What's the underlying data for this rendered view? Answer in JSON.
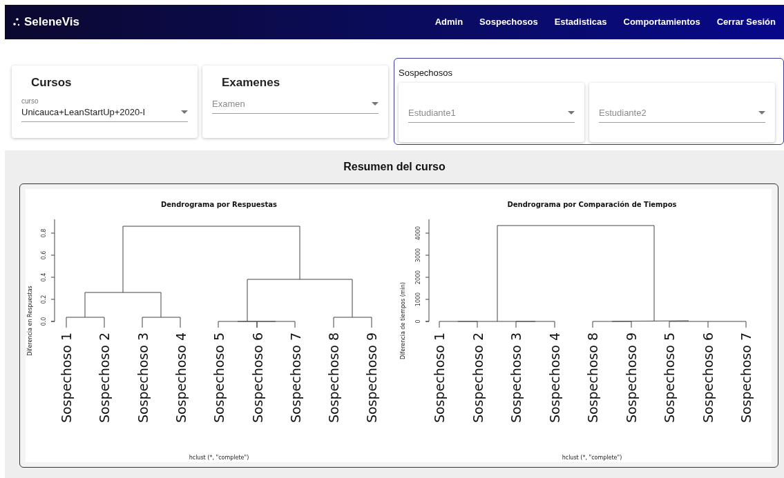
{
  "navbar": {
    "brand": "SeleneVis",
    "links": [
      "Admin",
      "Sospechosos",
      "Estadisticas",
      "Comportamientos",
      "Cerrar Sesión"
    ]
  },
  "filters": [
    {
      "title": "Cursos",
      "label": "curso",
      "value": "Unicauca+LeanStartUp+2020-I"
    },
    {
      "title": "Examenes",
      "placeholder": "Examen"
    }
  ],
  "suspects": {
    "title": "Sospechosos",
    "fields": [
      {
        "placeholder": "Estudiante1"
      },
      {
        "placeholder": "Estudiante2"
      }
    ]
  },
  "summary": {
    "title": "Resumen del curso",
    "plots": [
      {
        "title": "Dendrograma por Respuestas",
        "ylabel": "Diferencia en Respuestas",
        "yticks": [
          "0.0",
          "0.2",
          "0.4",
          "0.6",
          "0.8"
        ],
        "leaves": [
          "Sospechoso 1",
          "Sospechoso 2",
          "Sospechoso 3",
          "Sospechoso 4",
          "Sospechoso 5",
          "Sospechoso 6",
          "Sospechoso 7",
          "Sospechoso 8",
          "Sospechoso 9"
        ],
        "xlabel": "hclust (*, \"complete\")"
      },
      {
        "title": "Dendrograma por Comparación de Tiempos",
        "ylabel": "Diferencia de tiempos (min)",
        "yticks": [
          "0",
          "1000",
          "2000",
          "3000",
          "4000"
        ],
        "leaves": [
          "Sospechoso 1",
          "Sospechoso 2",
          "Sospechoso 3",
          "Sospechoso 4",
          "Sospechoso 8",
          "Sospechoso 9",
          "Sospechoso 5",
          "Sospechoso 6",
          "Sospechoso 7"
        ],
        "xlabel": "hclust (*, \"complete\")"
      }
    ]
  }
}
